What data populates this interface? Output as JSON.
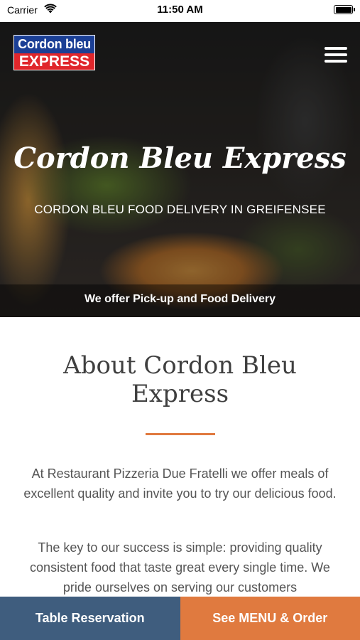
{
  "status_bar": {
    "carrier": "Carrier",
    "time": "11:50 AM",
    "battery_level": 1.0
  },
  "header": {
    "logo_top": "Cordon bleu",
    "logo_bottom": "EXPRESS",
    "menu_icon": "hamburger-menu-icon"
  },
  "hero": {
    "title": "Cordon Bleu Express",
    "subtitle": "CORDON BLEU FOOD DELIVERY IN GREIFENSEE",
    "band_text": "We offer Pick-up and Food Delivery"
  },
  "about": {
    "title": "About Cordon Bleu Express",
    "paragraph_1": "At Restaurant Pizzeria Due Fratelli we offer meals of excellent quality and invite you to try our delicious food.",
    "paragraph_2": "The key to our success is simple: providing quality consistent food that taste great every single time. We pride ourselves on serving our customers"
  },
  "actions": {
    "reservation_label": "Table Reservation",
    "order_label": "See MENU & Order"
  },
  "colors": {
    "accent_orange": "#e07a3f",
    "reservation_blue": "#3f5d7e",
    "logo_blue": "#1b3f95",
    "logo_red": "#e0262b"
  }
}
